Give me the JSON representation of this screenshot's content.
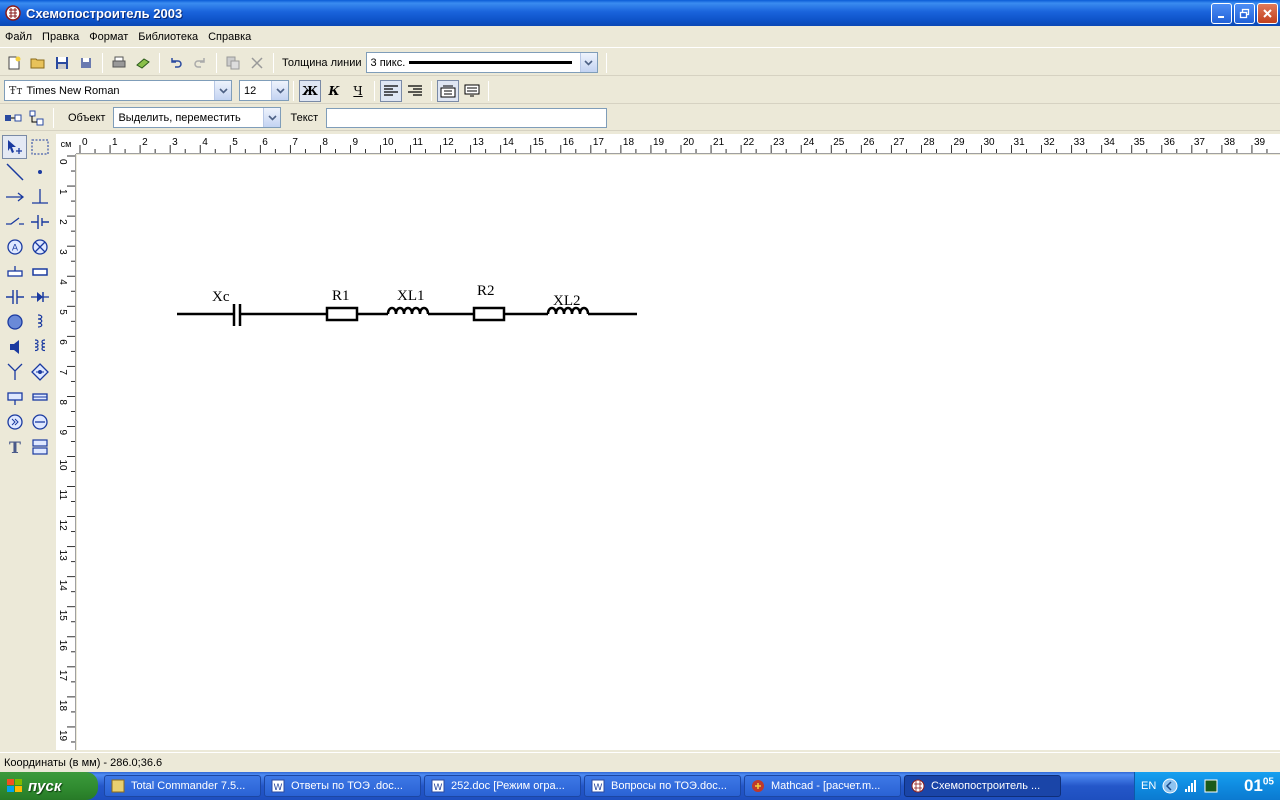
{
  "window": {
    "title": "Схемопостроитель 2003"
  },
  "menu": [
    "Файл",
    "Правка",
    "Формат",
    "Библиотека",
    "Справка"
  ],
  "toolbar1": {
    "line_width_label": "Толщина линии",
    "line_width_value": "3 пикс."
  },
  "toolbar2": {
    "font_value": "Times New Roman",
    "size_value": "12",
    "bold": "Ж",
    "italic": "К",
    "underline": "Ч"
  },
  "toolbar3": {
    "object_label": "Объект",
    "object_value": "Выделить, переместить",
    "text_label": "Текст",
    "text_value": ""
  },
  "ruler": {
    "unit": "см",
    "top_ticks": [
      "0",
      "1",
      "2",
      "3",
      "4",
      "5",
      "6",
      "7",
      "8",
      "9",
      "10",
      "11",
      "12",
      "13",
      "14",
      "15",
      "16",
      "17",
      "18",
      "19",
      "20",
      "21",
      "22",
      "23",
      "24",
      "25",
      "26",
      "27",
      "28",
      "29",
      "30",
      "31",
      "32",
      "33",
      "34",
      "35",
      "36",
      "37",
      "38",
      "39"
    ],
    "left_ticks": [
      "0",
      "1",
      "2",
      "3",
      "4",
      "5",
      "6",
      "7",
      "8",
      "9",
      "10",
      "11",
      "12",
      "13",
      "14",
      "15",
      "16",
      "17",
      "18",
      "19"
    ]
  },
  "circuit": {
    "labels": [
      "Xc",
      "R1",
      "XL1",
      "R2",
      "XL2"
    ]
  },
  "status": {
    "coords": "Координаты (в мм) - 286.0;36.6"
  },
  "taskbar": {
    "start": "пуск",
    "tasks": [
      "Total Commander 7.5...",
      "Ответы по ТОЭ .doc...",
      "252.doc [Режим огра...",
      "Вопросы по ТОЭ.doc...",
      "Mathcad - [расчет.m...",
      "Схемопостроитель ..."
    ],
    "lang": "EN",
    "clock_h": "01",
    "clock_m": "05"
  },
  "colors": {
    "titlebar": "#0d52c7",
    "icon_blue": "#1a3aa0",
    "canvas": "#ffffff"
  }
}
